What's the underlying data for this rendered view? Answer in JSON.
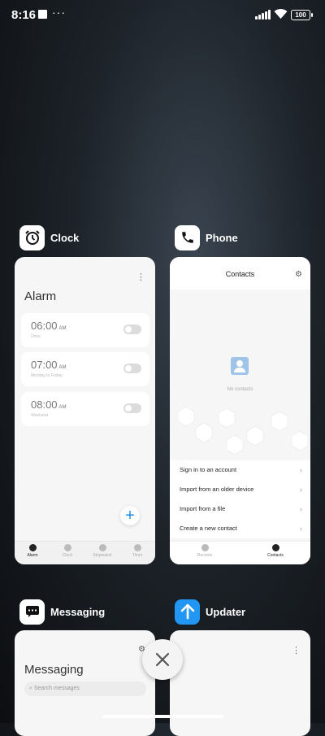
{
  "status_bar": {
    "time": "8:16",
    "dots": "···",
    "battery": "100"
  },
  "apps": {
    "clock": {
      "name": "Clock",
      "title": "Alarm",
      "alarms": [
        {
          "time": "06:00",
          "ampm": "AM",
          "sub": "Once"
        },
        {
          "time": "07:00",
          "ampm": "AM",
          "sub": "Monday to Friday"
        },
        {
          "time": "08:00",
          "ampm": "AM",
          "sub": "Weekend"
        }
      ],
      "tabs": [
        "Alarm",
        "Clock",
        "Stopwatch",
        "Timer"
      ]
    },
    "phone": {
      "name": "Phone",
      "title": "Contacts",
      "empty_text": "No contacts",
      "options": [
        "Sign in to an account",
        "Import from an older device",
        "Import from a file",
        "Create a new contact"
      ],
      "tabs": [
        "Recents",
        "Contacts"
      ]
    },
    "messaging": {
      "name": "Messaging",
      "title": "Messaging",
      "search_placeholder": "Search messages"
    },
    "updater": {
      "name": "Updater"
    }
  },
  "colors": {
    "accent": "#1e88e5",
    "updater_icon": "#2196f3"
  }
}
